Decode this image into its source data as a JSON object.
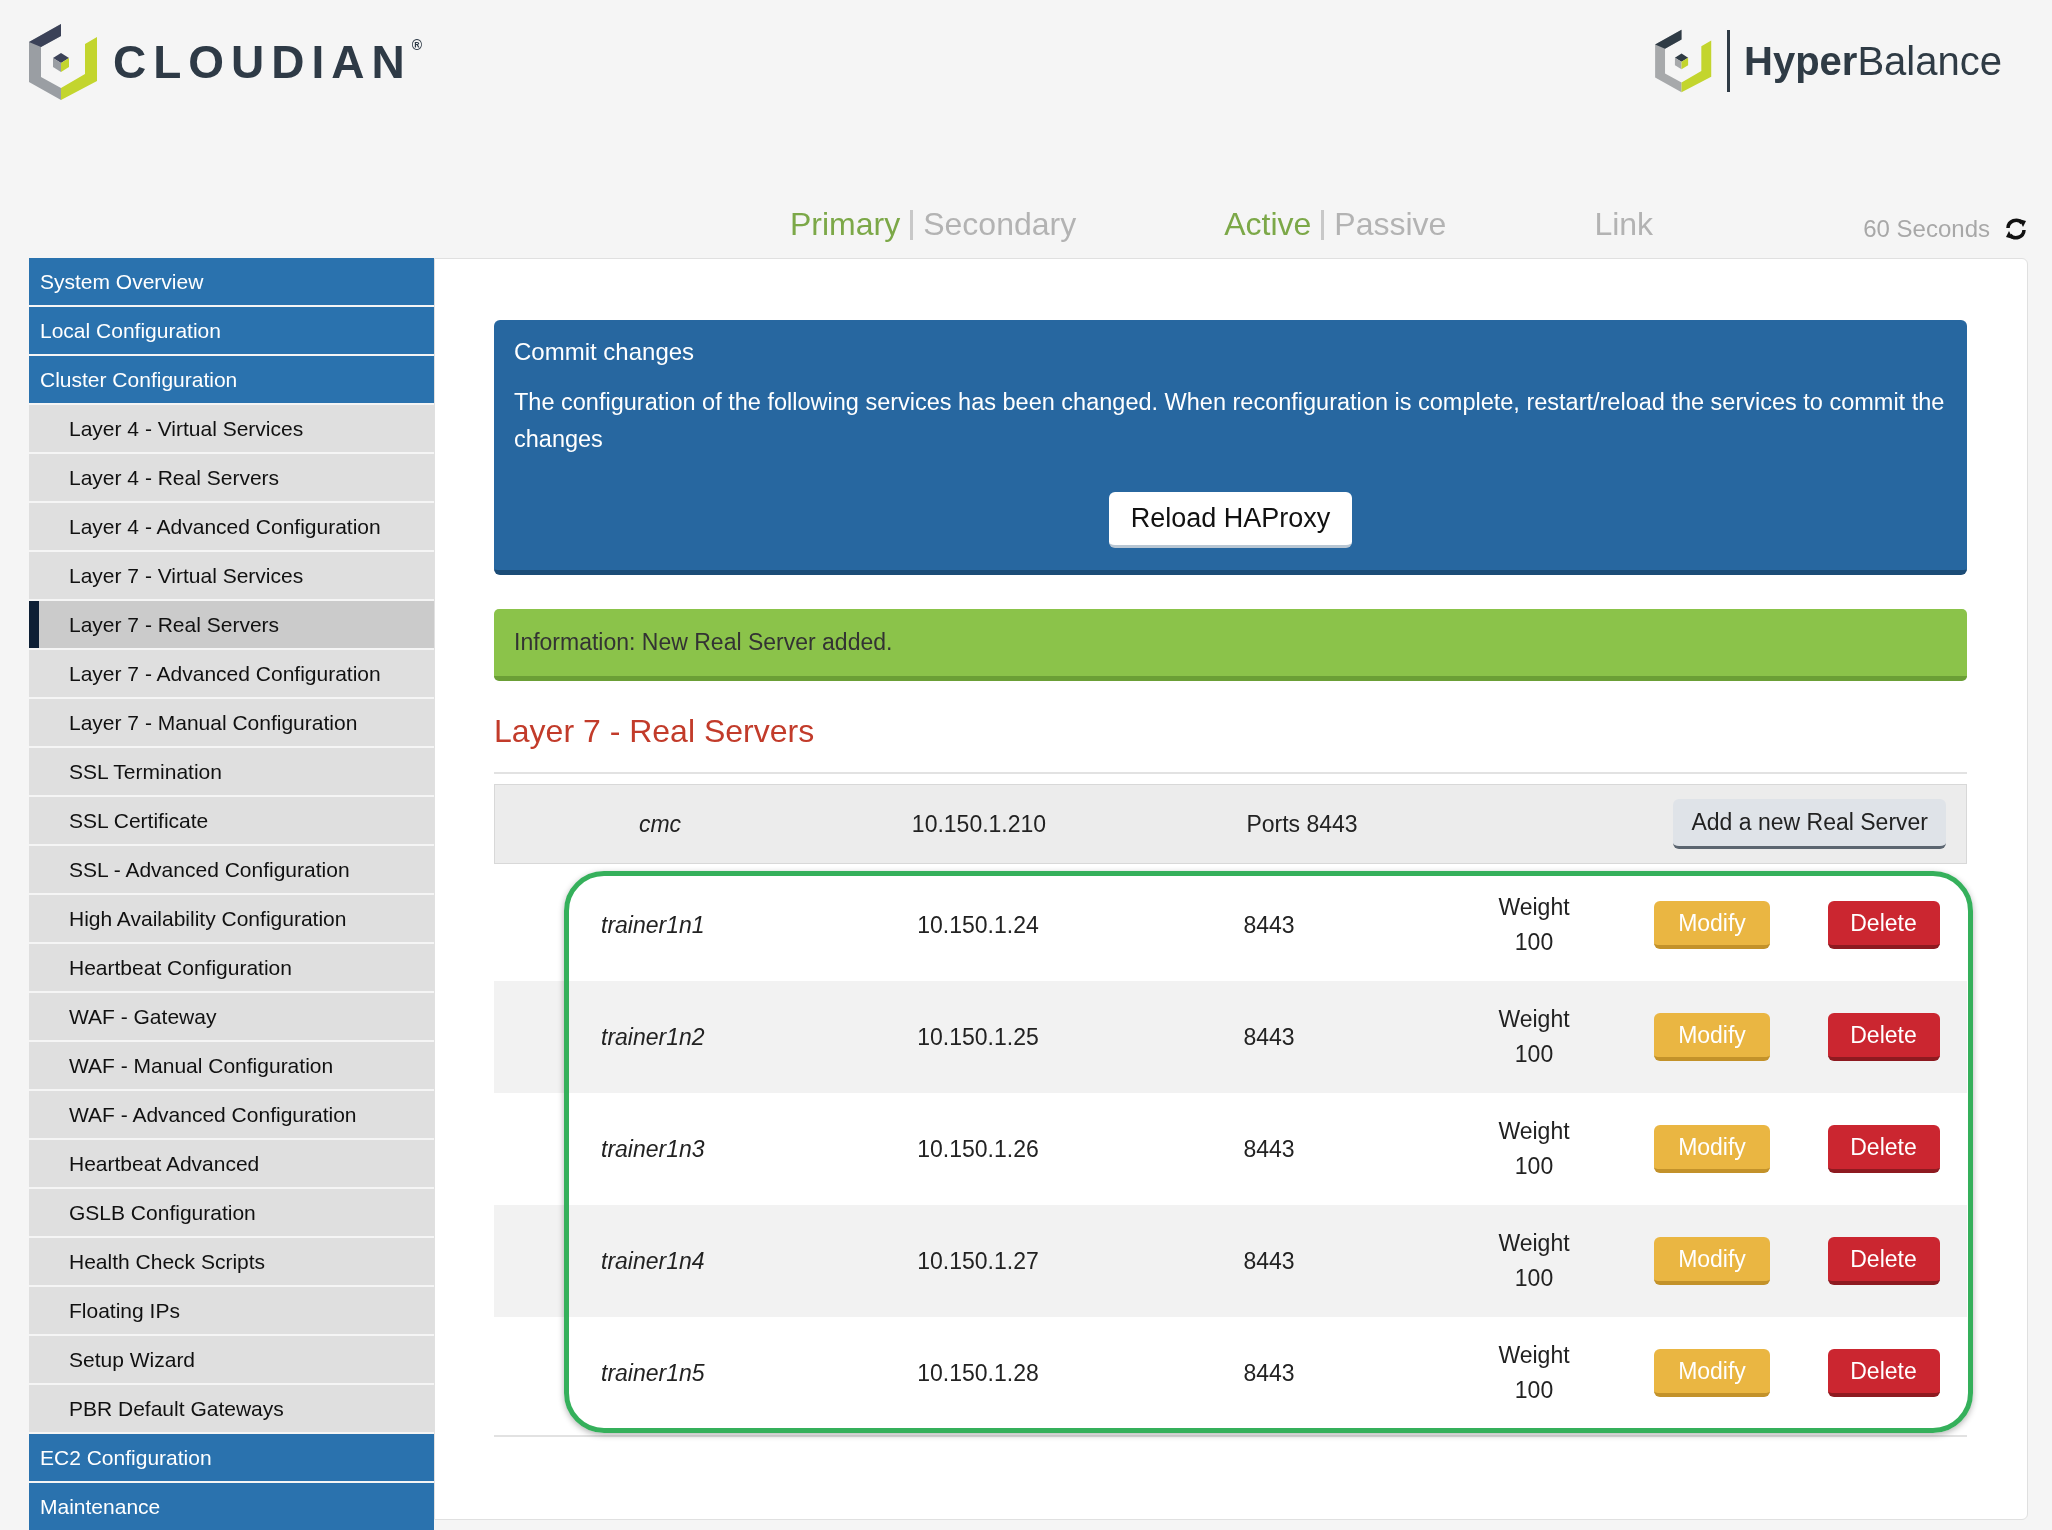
{
  "header": {
    "logo": {
      "name": "CLOUDIAN",
      "mark": "®"
    },
    "product": "**Hyper**Balance"
  },
  "status_bar": {
    "groups": [
      {
        "items": [
          {
            "label": "Primary",
            "selected": true
          },
          {
            "label": "Secondary",
            "selected": false
          }
        ]
      },
      {
        "items": [
          {
            "label": "Active",
            "selected": true
          },
          {
            "label": "Passive",
            "selected": false
          }
        ]
      },
      {
        "items": [
          {
            "label": "Link",
            "selected": false
          }
        ]
      }
    ],
    "refresh": "60 Seconds"
  },
  "sidebar": {
    "items": [
      {
        "label": "System Overview",
        "kind": "section",
        "selected": false
      },
      {
        "label": "Local Configuration",
        "kind": "section",
        "selected": false
      },
      {
        "label": "Cluster Configuration",
        "kind": "section",
        "selected": false
      },
      {
        "label": "Layer 4 - Virtual Services",
        "kind": "sub",
        "selected": false
      },
      {
        "label": "Layer 4 - Real Servers",
        "kind": "sub",
        "selected": false
      },
      {
        "label": "Layer 4 - Advanced Configuration",
        "kind": "sub",
        "selected": false
      },
      {
        "label": "Layer 7 - Virtual Services",
        "kind": "sub",
        "selected": false
      },
      {
        "label": "Layer 7 - Real Servers",
        "kind": "sub",
        "selected": true
      },
      {
        "label": "Layer 7 - Advanced Configuration",
        "kind": "sub",
        "selected": false
      },
      {
        "label": "Layer 7 - Manual Configuration",
        "kind": "sub",
        "selected": false
      },
      {
        "label": "SSL Termination",
        "kind": "sub",
        "selected": false
      },
      {
        "label": "SSL Certificate",
        "kind": "sub",
        "selected": false
      },
      {
        "label": "SSL - Advanced Configuration",
        "kind": "sub",
        "selected": false
      },
      {
        "label": "High Availability Configuration",
        "kind": "sub",
        "selected": false
      },
      {
        "label": "Heartbeat Configuration",
        "kind": "sub",
        "selected": false
      },
      {
        "label": "WAF - Gateway",
        "kind": "sub",
        "selected": false
      },
      {
        "label": "WAF - Manual Configuration",
        "kind": "sub",
        "selected": false
      },
      {
        "label": "WAF - Advanced Configuration",
        "kind": "sub",
        "selected": false
      },
      {
        "label": "Heartbeat Advanced",
        "kind": "sub",
        "selected": false
      },
      {
        "label": "GSLB Configuration",
        "kind": "sub",
        "selected": false
      },
      {
        "label": "Health Check Scripts",
        "kind": "sub",
        "selected": false
      },
      {
        "label": "Floating IPs",
        "kind": "sub",
        "selected": false
      },
      {
        "label": "Setup Wizard",
        "kind": "sub",
        "selected": false
      },
      {
        "label": "PBR Default Gateways",
        "kind": "sub",
        "selected": false
      },
      {
        "label": "EC2 Configuration",
        "kind": "section",
        "selected": false
      },
      {
        "label": "Maintenance",
        "kind": "section",
        "selected": false
      }
    ]
  },
  "commit": {
    "title": "Commit changes",
    "message": "The configuration of the following services has been changed. When reconfiguration is complete, restart/reload the services to commit the changes",
    "button": "Reload HAProxy"
  },
  "info": "Information: New Real Server added.",
  "heading": "Layer 7 - Real Servers",
  "table": {
    "header": {
      "name": "cmc",
      "ip": "10.150.1.210",
      "ports": "Ports 8443",
      "button": "Add a new Real Server"
    },
    "rows": [
      {
        "name": "trainer1n1",
        "ip": "10.150.1.24",
        "port": "8443",
        "weight_label": "Weight",
        "weight": "100",
        "modify": "Modify",
        "delete": "Delete"
      },
      {
        "name": "trainer1n2",
        "ip": "10.150.1.25",
        "port": "8443",
        "weight_label": "Weight",
        "weight": "100",
        "modify": "Modify",
        "delete": "Delete"
      },
      {
        "name": "trainer1n3",
        "ip": "10.150.1.26",
        "port": "8443",
        "weight_label": "Weight",
        "weight": "100",
        "modify": "Modify",
        "delete": "Delete"
      },
      {
        "name": "trainer1n4",
        "ip": "10.150.1.27",
        "port": "8443",
        "weight_label": "Weight",
        "weight": "100",
        "modify": "Modify",
        "delete": "Delete"
      },
      {
        "name": "trainer1n5",
        "ip": "10.150.1.28",
        "port": "8443",
        "weight_label": "Weight",
        "weight": "100",
        "modify": "Modify",
        "delete": "Delete"
      }
    ]
  }
}
